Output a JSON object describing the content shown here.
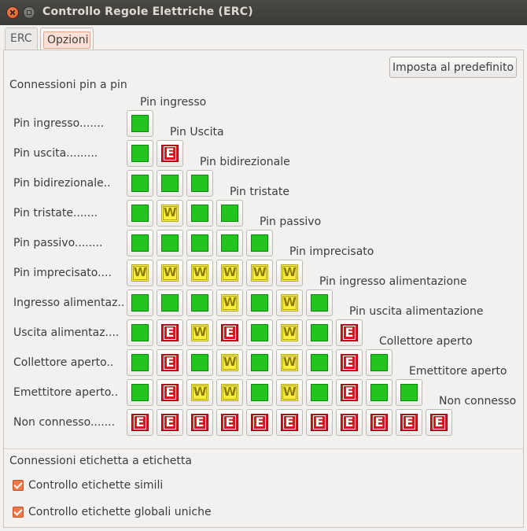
{
  "window": {
    "title": "Controllo Regole Elettriche (ERC)"
  },
  "tabs": [
    {
      "label": "ERC"
    },
    {
      "label": "Opzioni"
    }
  ],
  "reset_button": {
    "label": "Imposta al predefinito"
  },
  "pin_section": {
    "title": "Connessioni pin a pin"
  },
  "row_labels": [
    "Pin ingresso.......",
    "Pin uscita.........",
    "Pin bidirezionale..",
    "Pin tristate.......",
    "Pin passivo........",
    "Pin imprecisato....",
    "Ingresso alimentaz..",
    "Uscita alimentaz....",
    "Collettore aperto..",
    "Emettitore aperto..",
    "Non connesso......."
  ],
  "column_labels": [
    "Pin ingresso",
    "Pin Uscita",
    "Pin bidirezionale",
    "Pin tristate",
    "Pin passivo",
    "Pin imprecisato",
    "Pin ingresso alimentazione",
    "Pin uscita alimentazione",
    "Collettore aperto",
    "Emettitore aperto",
    "Non connesso"
  ],
  "matrix": [
    [
      "ok"
    ],
    [
      "ok",
      "error"
    ],
    [
      "ok",
      "ok",
      "ok"
    ],
    [
      "ok",
      "warning",
      "ok",
      "ok"
    ],
    [
      "ok",
      "ok",
      "ok",
      "ok",
      "ok"
    ],
    [
      "warning",
      "warning",
      "warning",
      "warning",
      "warning",
      "warning"
    ],
    [
      "ok",
      "ok",
      "ok",
      "warning",
      "ok",
      "warning",
      "ok"
    ],
    [
      "ok",
      "error",
      "warning",
      "error",
      "ok",
      "warning",
      "ok",
      "error"
    ],
    [
      "ok",
      "error",
      "ok",
      "warning",
      "ok",
      "warning",
      "ok",
      "error",
      "ok"
    ],
    [
      "ok",
      "error",
      "warning",
      "warning",
      "ok",
      "warning",
      "ok",
      "error",
      "ok",
      "ok"
    ],
    [
      "error",
      "error",
      "error",
      "error",
      "error",
      "error",
      "error",
      "error",
      "error",
      "error",
      "error"
    ]
  ],
  "legend": {
    "error_letter": "E",
    "warning_letter": "W"
  },
  "label_section": {
    "title": "Connessioni etichetta a etichetta",
    "options": [
      {
        "label": "Controllo etichette simili",
        "checked": true
      },
      {
        "label": "Controllo etichette globali uniche",
        "checked": true
      }
    ]
  },
  "colors": {
    "ok": "#22c41e",
    "error": "#d4161e",
    "warning": "#fdf560",
    "accent": "#ef7849"
  }
}
